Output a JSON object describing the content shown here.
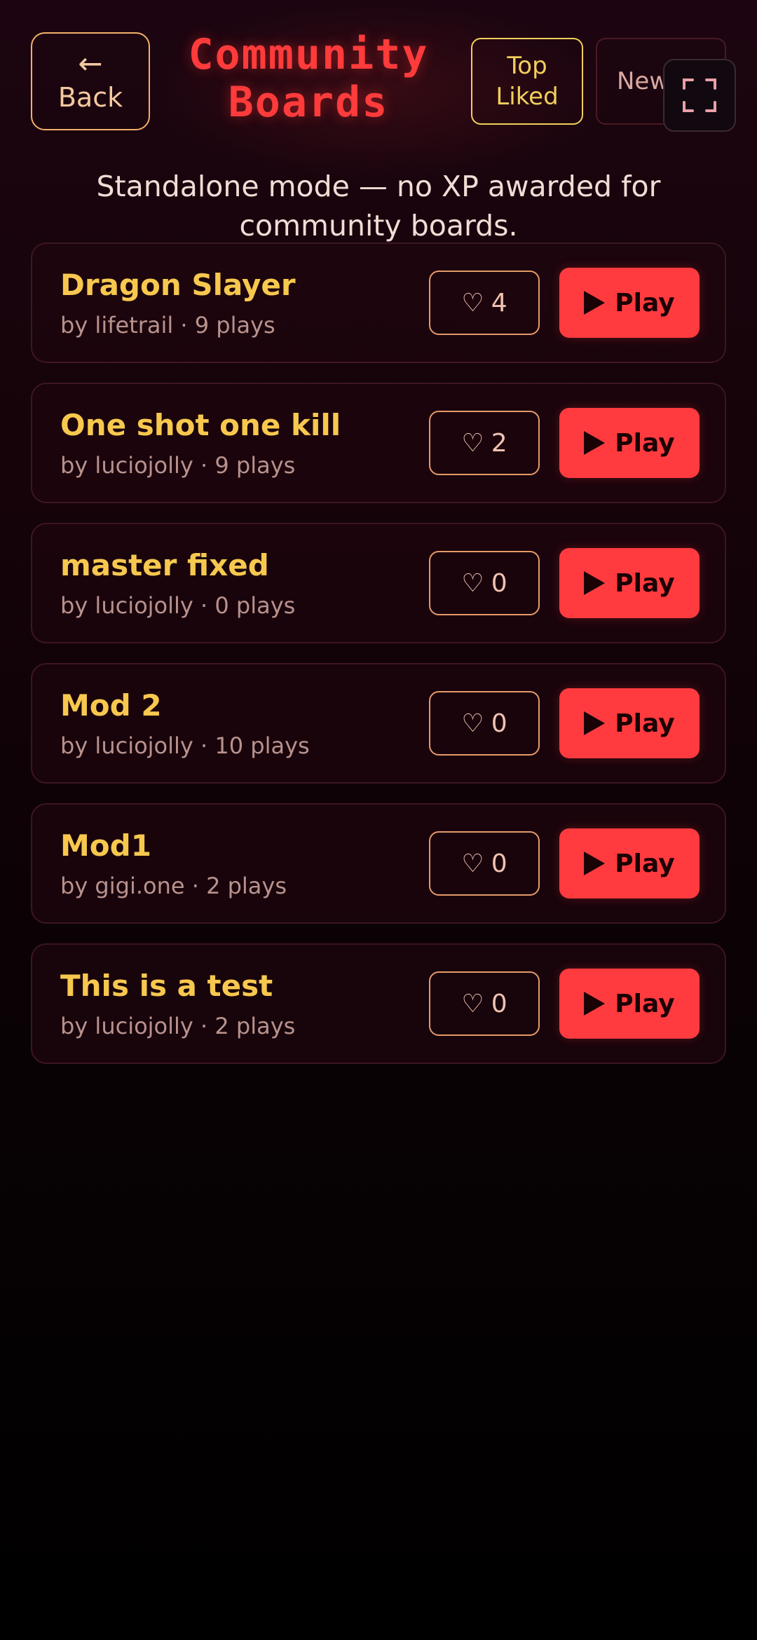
{
  "header": {
    "back_arrow": "←",
    "back_label": "Back",
    "title_line1": "Community",
    "title_line2": "Boards",
    "tab_top_line1": "Top",
    "tab_top_line2": "Liked",
    "tab_new": "New",
    "fullscreen_icon": "fullscreen-icon"
  },
  "notice": "Standalone mode — no XP awarded for community boards.",
  "boards": [
    {
      "title": "Dragon Slayer",
      "meta": "by lifetrail · 9 plays",
      "likes": "4",
      "play": "Play"
    },
    {
      "title": "One shot one kill",
      "meta": "by luciojolly · 9 plays",
      "likes": "2",
      "play": "Play"
    },
    {
      "title": "master fixed",
      "meta": "by luciojolly · 0 plays",
      "likes": "0",
      "play": "Play"
    },
    {
      "title": "Mod 2",
      "meta": "by luciojolly · 10 plays",
      "likes": "0",
      "play": "Play"
    },
    {
      "title": "Mod1",
      "meta": "by gigi.one · 2 plays",
      "likes": "0",
      "play": "Play"
    },
    {
      "title": "This is a test",
      "meta": "by luciojolly · 2 plays",
      "likes": "0",
      "play": "Play"
    }
  ],
  "icons": {
    "heart": "♡"
  },
  "colors": {
    "accent_red": "#ff3b3f",
    "title_yellow": "#f7c84e",
    "back_border": "#f5b06a",
    "tab_active": "#f2cf5c"
  }
}
